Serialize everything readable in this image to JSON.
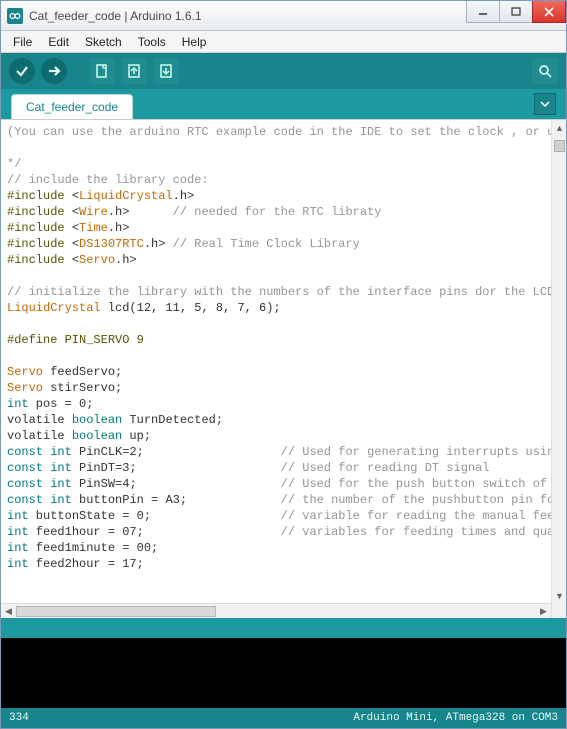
{
  "window": {
    "title": "Cat_feeder_code | Arduino 1.6.1"
  },
  "menu": {
    "items": [
      "File",
      "Edit",
      "Sketch",
      "Tools",
      "Help"
    ]
  },
  "tabs": {
    "active": "Cat_feeder_code"
  },
  "code": {
    "lines": [
      {
        "t": "comment",
        "text": "(You can use the arduino RTC example code in the IDE to set the clock , or us"
      },
      {
        "t": "blank",
        "text": ""
      },
      {
        "t": "comment",
        "text": "*/"
      },
      {
        "t": "comment",
        "text": "// include the library code:"
      },
      {
        "t": "include",
        "lib": "LiquidCrystal",
        "ext": ".h>",
        "comment": ""
      },
      {
        "t": "include",
        "lib": "Wire",
        "ext": ".h>      ",
        "comment": "// needed for the RTC libraty"
      },
      {
        "t": "include",
        "lib": "Time",
        "ext": ".h>",
        "comment": ""
      },
      {
        "t": "include",
        "lib": "DS1307RTC",
        "ext": ".h> ",
        "comment": "// Real Time Clock Library"
      },
      {
        "t": "include",
        "lib": "Servo",
        "ext": ".h>",
        "comment": ""
      },
      {
        "t": "blank",
        "text": ""
      },
      {
        "t": "comment",
        "text": "// initialize the library with the numbers of the interface pins dor the LCD"
      },
      {
        "t": "lcd",
        "class": "LiquidCrystal",
        "rest": " lcd(12, 11, 5, 8, 7, 6);"
      },
      {
        "t": "blank",
        "text": ""
      },
      {
        "t": "define",
        "text": "#define PIN_SERVO 9"
      },
      {
        "t": "blank",
        "text": ""
      },
      {
        "t": "decl",
        "class": "Servo",
        "rest": " feedServo;"
      },
      {
        "t": "decl",
        "class": "Servo",
        "rest": " stirServo;"
      },
      {
        "t": "decl2",
        "kw": "int",
        "rest": " pos = 0;"
      },
      {
        "t": "decl3",
        "kw1": "volatile",
        "kw2": "boolean",
        "rest": " TurnDetected;"
      },
      {
        "t": "decl3",
        "kw1": "volatile",
        "kw2": "boolean",
        "rest": " up;"
      },
      {
        "t": "decl4",
        "kw1": "const",
        "kw2": "int",
        "rest": " PinCLK=2;",
        "pad": "                   ",
        "comment": "// Used for generating interrupts using"
      },
      {
        "t": "decl4",
        "kw1": "const",
        "kw2": "int",
        "rest": " PinDT=3;",
        "pad": "                    ",
        "comment": "// Used for reading DT signal"
      },
      {
        "t": "decl4",
        "kw1": "const",
        "kw2": "int",
        "rest": " PinSW=4;",
        "pad": "                    ",
        "comment": "// Used for the push button switch of t"
      },
      {
        "t": "decl4",
        "kw1": "const",
        "kw2": "int",
        "rest": " buttonPin = A3;",
        "pad": "             ",
        "comment": "// the number of the pushbutton pin for"
      },
      {
        "t": "decl5",
        "kw": "int",
        "rest": " buttonState = 0;",
        "pad": "                  ",
        "comment": "// variable for reading the manual feed"
      },
      {
        "t": "decl5",
        "kw": "int",
        "rest": " feed1hour = 07;",
        "pad": "                   ",
        "comment": "// variables for feeding times and quan"
      },
      {
        "t": "decl2",
        "kw": "int",
        "rest": " feed1minute = 00;"
      },
      {
        "t": "decl2",
        "kw": "int",
        "rest": " feed2hour = 17;"
      }
    ]
  },
  "status": {
    "line": "334",
    "board": "Arduino Mini, ATmega328 on COM3"
  }
}
